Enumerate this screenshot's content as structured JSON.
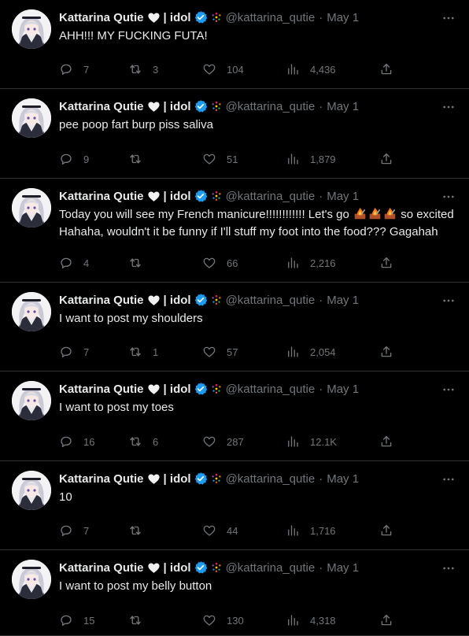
{
  "colors": {
    "background": "#000000",
    "text": "#e7e9ea",
    "muted": "#71767b",
    "verified": "#1d9bf0",
    "divider": "#2f3336"
  },
  "tweets": [
    {
      "name": "Kattarina Qutie",
      "tag": "| idol",
      "handle": "@kattarina_qutie",
      "date": "May 1",
      "text": "AHH!!! MY FUCKING FUTA!",
      "text2": "",
      "replies": "7",
      "retweets": "3",
      "likes": "104",
      "views": "4,436"
    },
    {
      "name": "Kattarina Qutie",
      "tag": "| idol",
      "handle": "@kattarina_qutie",
      "date": "May 1",
      "text": "pee poop fart burp piss saliva",
      "text2": "",
      "replies": "9",
      "retweets": "",
      "likes": "51",
      "views": "1,879"
    },
    {
      "name": "Kattarina Qutie",
      "tag": "| idol",
      "handle": "@kattarina_qutie",
      "date": "May 1",
      "text": "Today you will see my French manicure!!!!!!!!!!!! Let's go",
      "text2": "so excited Hahaha, wouldn't it be funny if I'll stuff my foot into the food??? Gagahah",
      "replies": "4",
      "retweets": "",
      "likes": "66",
      "views": "2,216"
    },
    {
      "name": "Kattarina Qutie",
      "tag": "| idol",
      "handle": "@kattarina_qutie",
      "date": "May 1",
      "text": "I want to post my shoulders",
      "text2": "",
      "replies": "7",
      "retweets": "1",
      "likes": "57",
      "views": "2,054"
    },
    {
      "name": "Kattarina Qutie",
      "tag": "| idol",
      "handle": "@kattarina_qutie",
      "date": "May 1",
      "text": "I want to post my toes",
      "text2": "",
      "replies": "16",
      "retweets": "6",
      "likes": "287",
      "views": "12.1K"
    },
    {
      "name": "Kattarina Qutie",
      "tag": "| idol",
      "handle": "@kattarina_qutie",
      "date": "May 1",
      "text": "10",
      "text2": "",
      "replies": "7",
      "retweets": "",
      "likes": "44",
      "views": "1,716"
    },
    {
      "name": "Kattarina Qutie",
      "tag": "| idol",
      "handle": "@kattarina_qutie",
      "date": "May 1",
      "text": "I want to post my belly button",
      "text2": "",
      "replies": "15",
      "retweets": "",
      "likes": "130",
      "views": "4,318"
    }
  ]
}
